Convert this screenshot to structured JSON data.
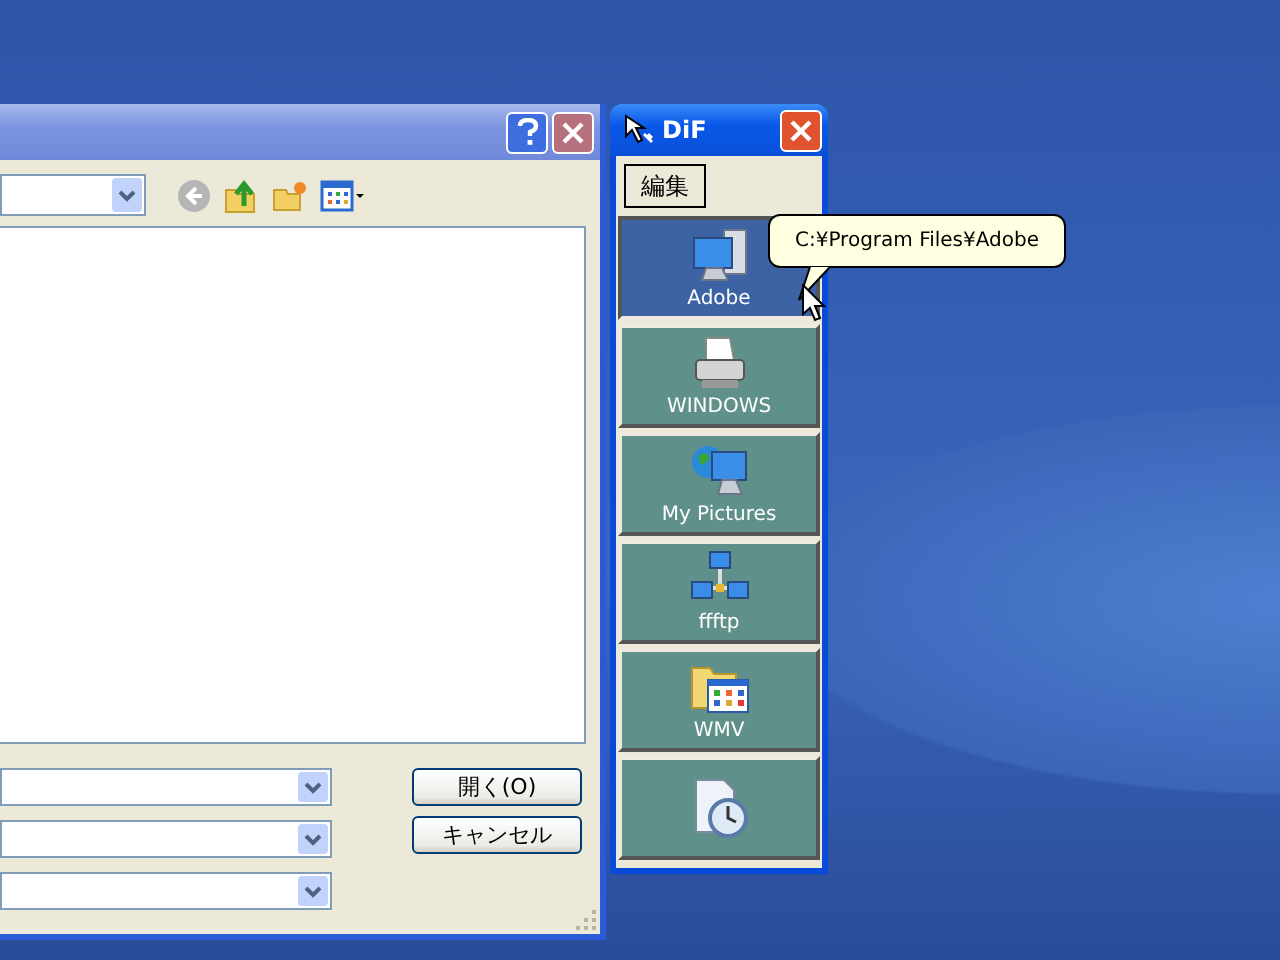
{
  "dialog": {
    "buttons": [
      {
        "label": "開く(O)"
      },
      {
        "label": "キャンセル"
      }
    ]
  },
  "dif_window": {
    "title": "DiF",
    "edit_button": "編集",
    "items": [
      {
        "label": "Adobe",
        "kind": "computer",
        "selected": true
      },
      {
        "label": "WINDOWS",
        "kind": "printer",
        "selected": false
      },
      {
        "label": "My Pictures",
        "kind": "globe",
        "selected": false
      },
      {
        "label": "ffftp",
        "kind": "network",
        "selected": false
      },
      {
        "label": "WMV",
        "kind": "folder",
        "selected": false
      },
      {
        "kind": "clock",
        "selected": false
      }
    ]
  },
  "tooltip": {
    "text": "C:¥Program Files¥Adobe"
  }
}
